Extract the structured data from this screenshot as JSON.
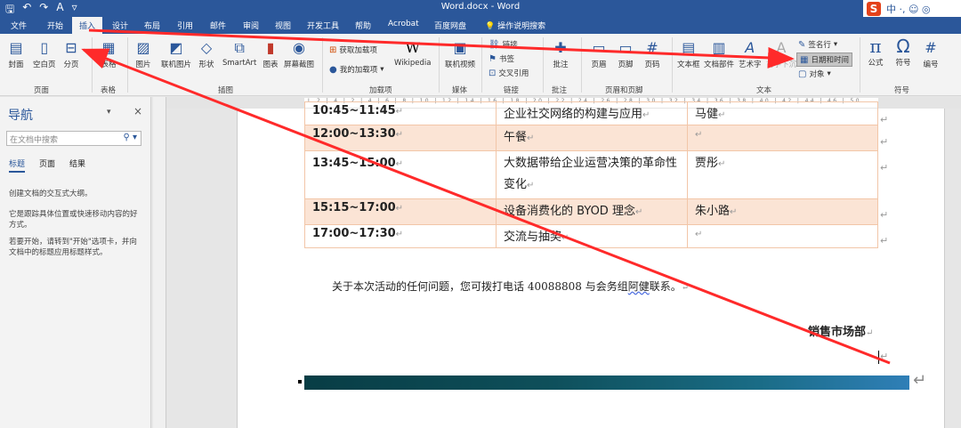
{
  "window": {
    "title": "Word.docx - Word"
  },
  "qat": {
    "save": "🖫",
    "undo": "↶",
    "redo": "↷",
    "font": "A",
    "more": "▿"
  },
  "ime": {
    "logo": "S",
    "text": "中 ·, ☺ ◎"
  },
  "tabs": [
    "文件",
    "开始",
    "插入",
    "设计",
    "布局",
    "引用",
    "邮件",
    "审阅",
    "视图",
    "开发工具",
    "帮助",
    "Acrobat",
    "百度网盘"
  ],
  "tellme": "操作说明搜索",
  "ribbon": {
    "pages": {
      "cover": "封面",
      "blank": "空白页",
      "break": "分页",
      "group": "页面"
    },
    "tables": {
      "table": "表格",
      "group": "表格"
    },
    "illustrations": {
      "pictures": "图片",
      "online_pictures": "联机图片",
      "shapes": "形状",
      "smartart": "SmartArt",
      "chart": "图表",
      "screenshot": "屏幕截图",
      "group": "插图"
    },
    "addins": {
      "get": "获取加载项",
      "my": "我的加载项",
      "wikipedia": "Wikipedia",
      "group": "加载项"
    },
    "media": {
      "online_video": "联机视频",
      "group": "媒体"
    },
    "links": {
      "link": "链接",
      "bookmark": "书签",
      "crossref": "交叉引用",
      "group": "链接"
    },
    "comments": {
      "comment": "批注",
      "group": "批注"
    },
    "headerfooter": {
      "header": "页眉",
      "footer": "页脚",
      "pagenum": "页码",
      "group": "页眉和页脚"
    },
    "text": {
      "textbox": "文本框",
      "quickparts": "文档部件",
      "wordart": "艺术字",
      "dropcap": "首字下沉",
      "signature": "签名行",
      "datetime": "日期和时间",
      "object": "对象",
      "group": "文本"
    },
    "symbols": {
      "equation": "公式",
      "symbol": "符号",
      "number": "编号",
      "group": "符号"
    }
  },
  "nav": {
    "title": "导航",
    "search_placeholder": "在文档中搜索",
    "tabs": [
      "标题",
      "页面",
      "结果"
    ],
    "p1": "创建文档的交互式大纲。",
    "p2": "它是跟踪具体位置或快速移动内容的好方式。",
    "p3": "若要开始，请转到\"开始\"选项卡，并向文档中的标题应用标题样式。"
  },
  "ruler": "L  2 | 4 | 2 | 4 | 6 | 8 | 10 | 12 | 14 | 16 | 18 | 20 | 22 | 24 | 26 | 28 | 30 | 32 | 34 | 36 | 38 | 40 | 42 | 44 | 46 | 50",
  "schedule": [
    {
      "time": "10:45~11:45",
      "topic": "企业社交网络的构建与应用",
      "speaker": "马健",
      "shaded": false
    },
    {
      "time": "12:00~13:30",
      "topic": "午餐",
      "speaker": "",
      "shaded": true
    },
    {
      "time": "13:45~15:00",
      "topic": "大数据带给企业运营决策的革命性变化",
      "speaker": "贾彤",
      "shaded": false
    },
    {
      "time": "15:15~17:00",
      "topic": "设备消费化的 BYOD 理念",
      "speaker": "朱小路",
      "shaded": true
    },
    {
      "time": "17:00~17:30",
      "topic": "交流与抽奖",
      "speaker": "",
      "shaded": false
    }
  ],
  "contact": {
    "before": "关于本次活动的任何问题，您可拨打电话 40088808 与会务组",
    "underlined": "阿健",
    "after": "联系。"
  },
  "dept": "销售市场部",
  "colors": {
    "accent": "#2b579a",
    "shade": "#fbe4d5",
    "border": "#f2c6a8",
    "arrow": "#ff2a2a"
  }
}
